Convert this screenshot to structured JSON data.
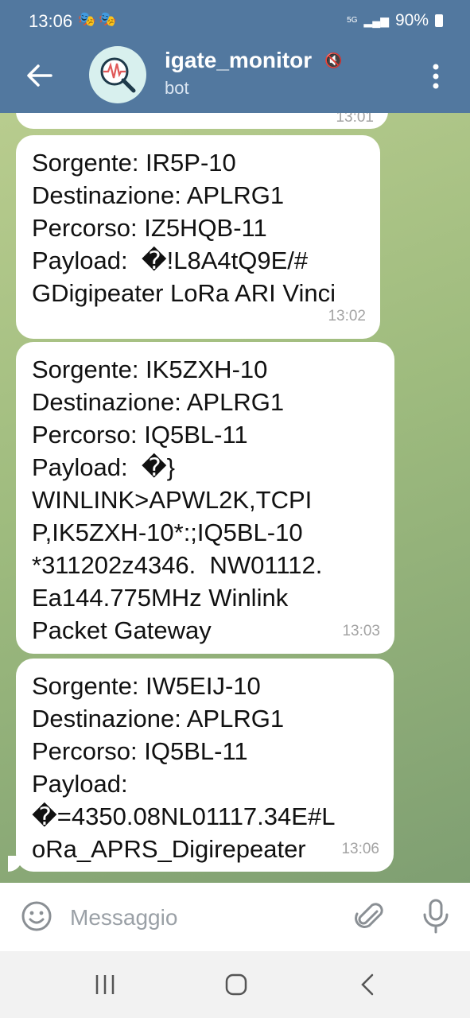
{
  "status_bar": {
    "time": "13:06",
    "masks": "🎭🎭",
    "network": "5G",
    "battery": "90%"
  },
  "header": {
    "title": "igate_monitor",
    "subtitle": "bot"
  },
  "messages": [
    {
      "text": "",
      "time": "13:01"
    },
    {
      "text": "Sorgente: IR5P-10\nDestinazione: APLRG1\nPercorso: IZ5HQB-11\nPayload:  �!L8A4tQ9E/#\nGDigipeater LoRa ARI Vinci",
      "time": "13:02"
    },
    {
      "text": "Sorgente: IK5ZXH-10\nDestinazione: APLRG1\nPercorso: IQ5BL-11\nPayload:  �}\nWINLINK>APWL2K,TCPI\nP,IK5ZXH-10*:;IQ5BL-10\n*311202z4346.  NW01112.\nEa144.775MHz Winlink\nPacket Gateway",
      "time": "13:03"
    },
    {
      "text": "Sorgente: IW5EIJ-10\nDestinazione: APLRG1\nPercorso: IQ5BL-11\nPayload:\n�=4350.08NL01117.34E#L\noRa_APRS_Digirepeater",
      "time": "13:06"
    }
  ],
  "input": {
    "placeholder": "Messaggio"
  },
  "icons": {
    "back": "arrow-left-icon",
    "avatar": "magnifier-waveform-icon",
    "mute": "muted-speaker-icon",
    "menu": "kebab-menu-icon",
    "emoji": "smiley-icon",
    "attach": "paperclip-icon",
    "mic": "microphone-icon",
    "recents": "recents-icon",
    "home": "home-icon",
    "nav_back": "chevron-left-icon"
  },
  "colors": {
    "header": "#52789f",
    "bubble": "#ffffff",
    "timestamp": "#a3a3a3",
    "accent": "#e05a5a"
  }
}
